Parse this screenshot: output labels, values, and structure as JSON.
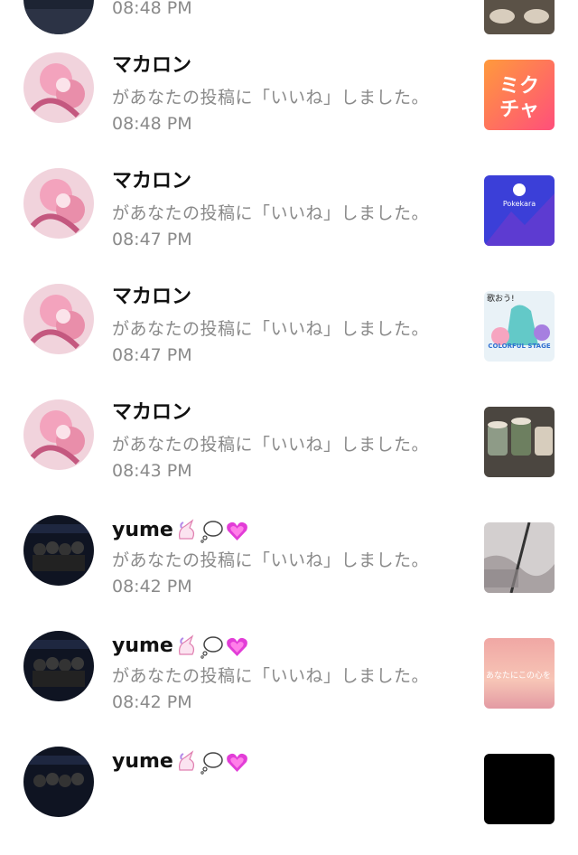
{
  "notifications": [
    {
      "name": "",
      "action": "",
      "time": "08:48 PM",
      "thumb": "drinks-thumbnail"
    },
    {
      "name": "マカロン",
      "action": "があなたの投稿に「いいね」しました。",
      "time": "08:48 PM",
      "thumb": "miku-app-icon",
      "thumb_text": "ミク\nチャ"
    },
    {
      "name": "マカロン",
      "action": "があなたの投稿に「いいね」しました。",
      "time": "08:47 PM",
      "thumb": "pokekara-app-icon",
      "thumb_text": "Pokekara"
    },
    {
      "name": "マカロン",
      "action": "があなたの投稿に「いいね」しました。",
      "time": "08:47 PM",
      "thumb": "colorful-stage-thumbnail",
      "thumb_text": "歌おう!",
      "thumb_text2": "COLORFUL STAGE"
    },
    {
      "name": "マカロン",
      "action": "があなたの投稿に「いいね」しました。",
      "time": "08:43 PM",
      "thumb": "drinks-thumbnail"
    },
    {
      "name": "yume",
      "action": "があなたの投稿に「いいね」しました。",
      "time": "08:42 PM",
      "thumb": "photo-thumbnail"
    },
    {
      "name": "yume",
      "action": "があなたの投稿に「いいね」しました。",
      "time": "08:42 PM",
      "thumb": "sunset-thumbnail",
      "thumb_text": "あなたにこの心を"
    },
    {
      "name": "yume",
      "action": "",
      "time": "",
      "thumb": "dark-thumbnail"
    }
  ],
  "colors": {
    "name": "#111111",
    "secondary": "#8a8a8a",
    "miku_gradient": [
      "#ff4f7b",
      "#ff9a3c"
    ],
    "pokekara": "#3b3fd8"
  }
}
